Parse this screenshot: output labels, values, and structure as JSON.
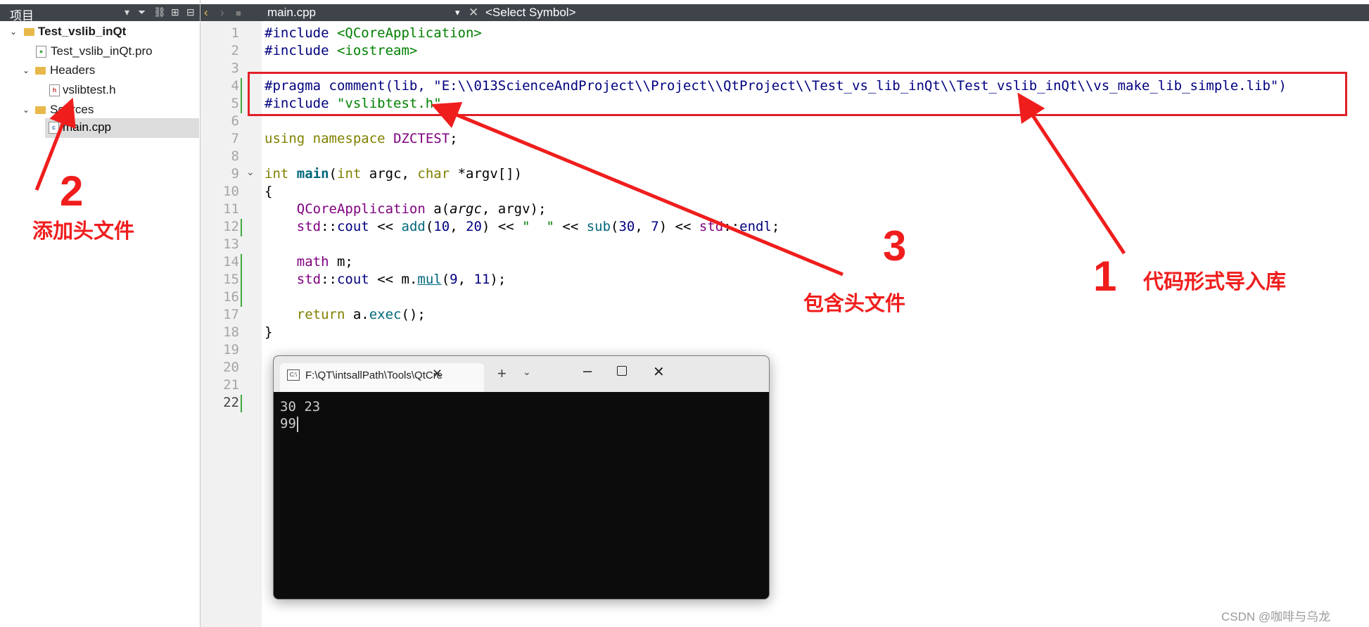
{
  "left_panel": {
    "header_title": "项目",
    "project_name": "Test_vslib_inQt",
    "pro_file": "Test_vslib_inQt.pro",
    "headers_folder": "Headers",
    "header_file": "vslibtest.h",
    "sources_folder": "Sources",
    "source_file": "main.cpp"
  },
  "editor": {
    "file_tab": "main.cpp",
    "symbol_selector": "<Select Symbol>",
    "line_numbers": [
      "1",
      "2",
      "3",
      "4",
      "5",
      "6",
      "7",
      "8",
      "9",
      "10",
      "11",
      "12",
      "13",
      "14",
      "15",
      "16",
      "17",
      "18",
      "19",
      "20",
      "21",
      "22"
    ],
    "code": {
      "l1_dir": "#include",
      "l1_arg": "<QCoreApplication>",
      "l2_dir": "#include",
      "l2_arg": "<iostream>",
      "l4_dir": "#pragma",
      "l4_fn": "comment",
      "l4_lib": "(lib,",
      "l4_str": "\"E:\\\\013ScienceAndProject\\\\Project\\\\QtProject\\\\Test_vs_lib_inQt\\\\Test_vslib_inQt\\\\vs_make_lib_simple.lib\"",
      "l4_end": ")",
      "l5_dir": "#include",
      "l5_arg": "\"vslibtest.h\"",
      "l7_using": "using",
      "l7_ns": "namespace",
      "l7_name": "DZCTEST",
      "l7_end": ";",
      "l9_int": "int",
      "l9_main": "main",
      "l9_p1": "(",
      "l9_int2": "int",
      "l9_argc": " argc, ",
      "l9_char": "char",
      "l9_rest": " *argv[])",
      "l10": "{",
      "l11_cls": "QCoreApplication",
      "l11_a": " a(",
      "l11_argc": "argc",
      "l11_rest": ", argv);",
      "l12_std": "std",
      "l12_sep": "::",
      "l12_cout": "cout",
      "l12_op": " << ",
      "l12_add": "add",
      "l12_args1": "(",
      "l12_n1": "10",
      "l12_c1": ", ",
      "l12_n2": "20",
      "l12_c2": ") << ",
      "l12_str": "\"  \"",
      "l12_op2": " << ",
      "l12_sub": "sub",
      "l12_p": "(",
      "l12_n3": "30",
      "l12_c3": ", ",
      "l12_n4": "7",
      "l12_c4": ") << ",
      "l12_std2": "std",
      "l12_sep2": "::",
      "l12_endl": "endl",
      "l12_semi": ";",
      "l14_math": "math",
      "l14_m": " m;",
      "l15_std": "std",
      "l15_sep": "::",
      "l15_cout": "cout",
      "l15_op": " << m.",
      "l15_mul": "mul",
      "l15_p": "(",
      "l15_n1": "9",
      "l15_c": ", ",
      "l15_n2": "11",
      "l15_end": ");",
      "l17_ret": "return",
      "l17_rest": " a.",
      "l17_exec": "exec",
      "l17_end": "();",
      "l18": "}"
    }
  },
  "console": {
    "tab_title": "F:\\QT\\intsallPath\\Tools\\QtCre",
    "output_line1": "30  23",
    "output_line2": "99"
  },
  "annotations": {
    "n1": "1",
    "label1": "代码形式导入库",
    "n2": "2",
    "label2": "添加头文件",
    "n3": "3",
    "label3": "包含头文件"
  },
  "watermark": "CSDN @咖啡与乌龙",
  "colors": {
    "annotation_red": "#f01d1d",
    "toolbar_dark": "#3f444a",
    "console_bg": "#0c0c0c"
  }
}
